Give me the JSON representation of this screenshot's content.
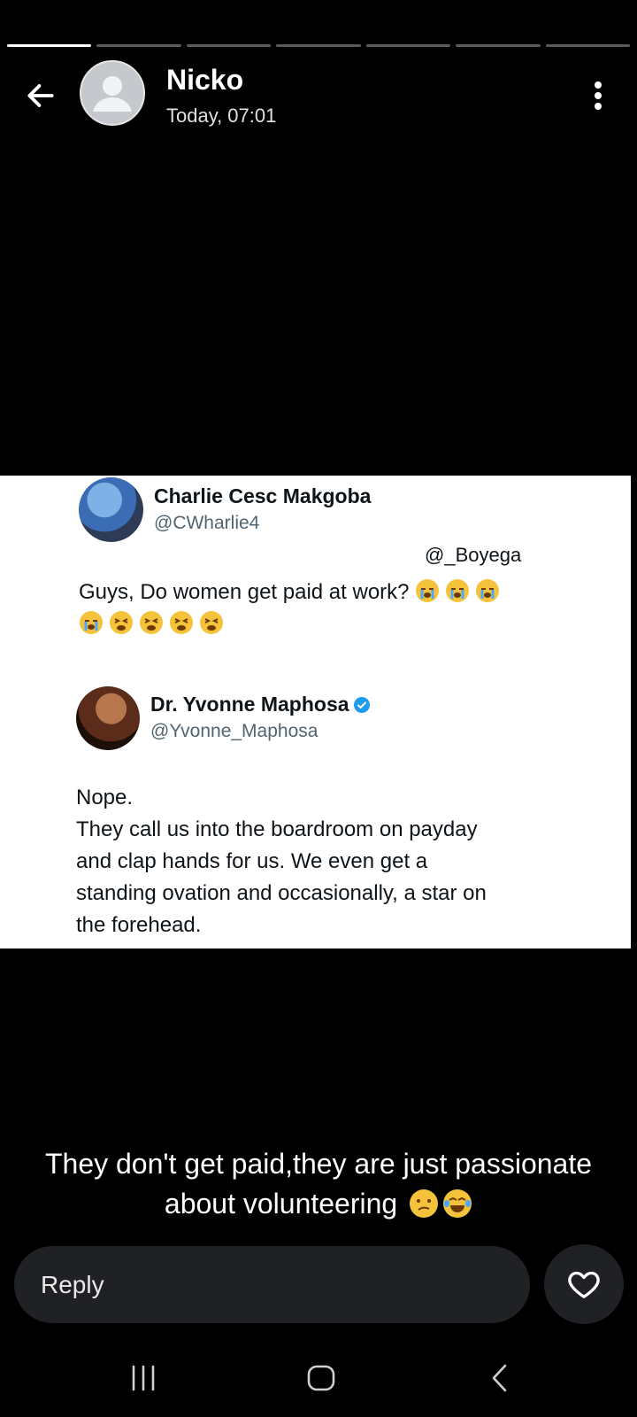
{
  "story": {
    "segments_total": 7,
    "segment_active": 1,
    "user_name": "Nicko",
    "timestamp": "Today, 07:01"
  },
  "tweet_image": {
    "first": {
      "name": "Charlie Cesc Makgoba",
      "handle": "@CWharlie4",
      "mention": "@_Boyega",
      "text": "Guys, Do women get paid at work?"
    },
    "second": {
      "name": "Dr. Yvonne Maphosa",
      "handle": "@Yvonne_Maphosa",
      "line1": "Nope.",
      "line2": "They call us into the boardroom on payday",
      "line3": "and clap hands for us. We even get a",
      "line4": "standing ovation and occasionally, a star on",
      "line5": "the forehead."
    }
  },
  "caption": {
    "line1": "They don't get paid,they are just passionate",
    "line2": "about volunteering"
  },
  "reply": {
    "placeholder": "Reply"
  },
  "icons": {
    "back": "arrow-left-icon",
    "more": "more-vertical-icon",
    "like": "heart-icon",
    "nav_recents": "recents-icon",
    "nav_home": "home-icon",
    "nav_back": "chevron-left-icon"
  },
  "colors": {
    "background": "#000000",
    "reply_bg": "#202124",
    "verified": "#1d9bf0"
  }
}
